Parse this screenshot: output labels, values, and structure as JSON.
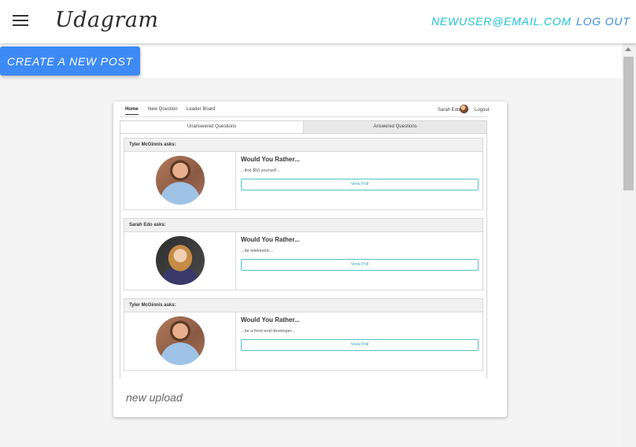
{
  "app": {
    "brand": "Udagram",
    "user_email": "NEWUSER@EMAIL.COM",
    "logout_label": "LOG OUT",
    "menu_icon": "hamburger-menu-icon"
  },
  "actions": {
    "create_post_label": "CREATE A NEW POST"
  },
  "post": {
    "caption": "new upload",
    "image": {
      "nav": {
        "tabs": [
          "Home",
          "New Question",
          "Leader Board"
        ],
        "active_tab": "Home",
        "user_name": "Sarah Edo",
        "logout": "Logout"
      },
      "question_tabs": [
        "Unanswered Questions",
        "Answered Questions"
      ],
      "questions": [
        {
          "author": "Tyler McGinnis asks:",
          "title": "Would You Rather...",
          "text": "...find $50 yourself...",
          "button": "View Poll"
        },
        {
          "author": "Sarah Edo asks:",
          "title": "Would You Rather...",
          "text": "...be telekinetic...",
          "button": "View Poll"
        },
        {
          "author": "Tyler McGinnis asks:",
          "title": "Would You Rather...",
          "text": "...be a front-end developer...",
          "button": "View Poll"
        }
      ]
    }
  },
  "colors": {
    "accent_cyan": "#21c2d6",
    "accent_blue": "#3a8ee6",
    "button_blue": "#3e8af5"
  }
}
